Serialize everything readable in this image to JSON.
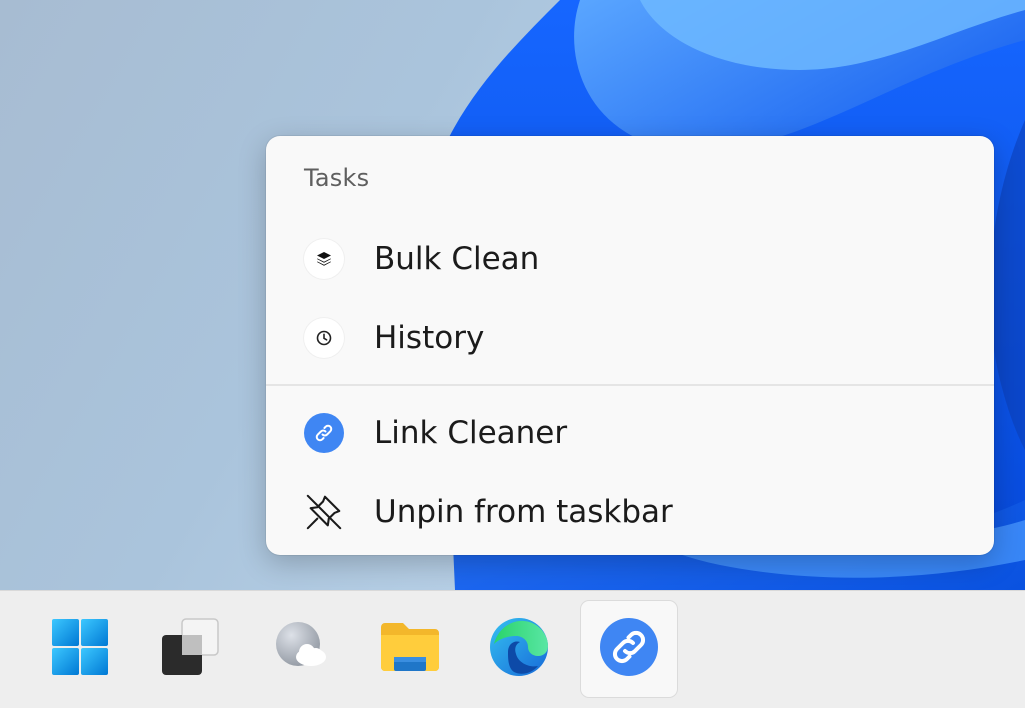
{
  "jumplist": {
    "header": "Tasks",
    "tasks": [
      {
        "label": "Bulk Clean",
        "icon": "layers-icon"
      },
      {
        "label": "History",
        "icon": "clock-icon"
      }
    ],
    "app_items": [
      {
        "label": "Link Cleaner",
        "icon": "link-app-icon"
      },
      {
        "label": "Unpin from taskbar",
        "icon": "unpin-icon"
      }
    ]
  },
  "taskbar": {
    "items": [
      {
        "name": "Start",
        "icon": "windows-start-icon"
      },
      {
        "name": "Task View",
        "icon": "task-view-icon"
      },
      {
        "name": "Widgets",
        "icon": "widgets-weather-icon"
      },
      {
        "name": "File Explorer",
        "icon": "folder-icon"
      },
      {
        "name": "Microsoft Edge",
        "icon": "edge-icon"
      },
      {
        "name": "Link Cleaner",
        "icon": "link-app-icon",
        "active": true
      }
    ]
  },
  "colors": {
    "accent": "#3f86f3",
    "menu_bg": "#f9f9f9",
    "taskbar_bg": "#eeeeee"
  }
}
